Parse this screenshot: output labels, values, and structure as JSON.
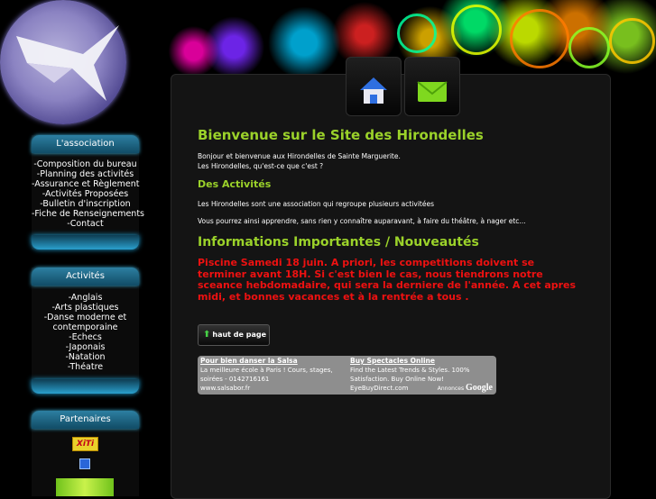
{
  "sidebar": {
    "association": {
      "title": "L'association",
      "items": [
        "-Composition du bureau",
        "-Planning des activités",
        "-Assurance et Règlement",
        "-Activités Proposées",
        "-Bulletin d'inscription",
        "-Fiche de Renseignements",
        "-Contact"
      ]
    },
    "activites": {
      "title": "Activités",
      "items": [
        "-Anglais",
        "-Arts plastiques",
        "-Danse moderne et",
        "contemporaine",
        "-Echecs",
        "-Japonais",
        "-Natation",
        "-Théatre"
      ]
    },
    "partenaires": {
      "title": "Partenaires",
      "xiti_label": "XiTi"
    }
  },
  "nav": {
    "accueil": "accueil",
    "contact": "contact"
  },
  "content": {
    "title": "Bienvenue sur le Site des Hirondelles",
    "intro_line1": "Bonjour et bienvenue aux Hirondelles de Sainte Marguerite.",
    "intro_line2": "Les Hirondelles, qu'est-ce que c'est ?",
    "activities_heading": "Des Activités",
    "activities_line1": "Les Hirondelles sont une association qui regroupe plusieurs activitées",
    "activities_line2": "Vous pourrez ainsi apprendre, sans rien y connaître auparavant, à faire du théâtre, à nager etc...",
    "info_heading": "Informations Importantes / Nouveautés",
    "alert": "Piscine Samedi 18 juin. A priori, les competitions doivent se terminer avant 18H. Si c'est bien le cas, nous tiendrons notre sceance hebdomadaire, qui sera la derniere de l'année. A cet apres midi, et bonnes vacances et à la rentrée a tous .",
    "top_button": "haut de page"
  },
  "ads": {
    "ad1": {
      "title": "Pour bien danser la Salsa",
      "line1": "La meilleure école à Paris ! Cours, stages,",
      "line2": "soirées - 0142716161",
      "line3": "www.salsabor.fr"
    },
    "ad2": {
      "title": "Buy Spectacles Online",
      "line1": "Find the Latest Trends & Styles. 100%",
      "line2": "Satisfaction. Buy Online Now!",
      "line3": "EyeBuyDirect.com"
    },
    "annonces": "Annonces",
    "google": "Google"
  }
}
